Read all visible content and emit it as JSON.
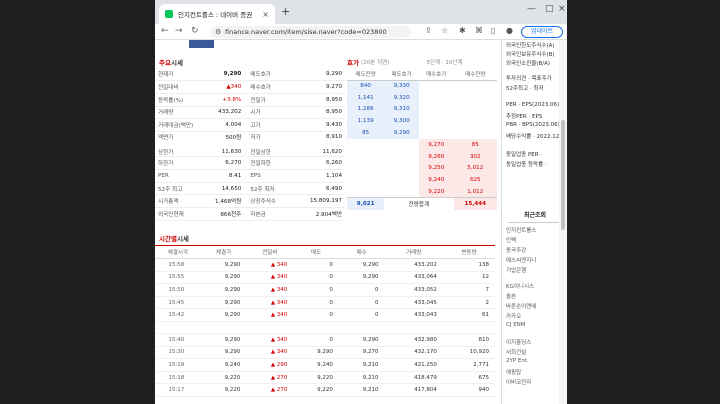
{
  "browser": {
    "tab_title": "인지컨트롤스 : 네이버 증권",
    "url": "finance.naver.com/item/sise.naver?code=023800",
    "update_label": "업데이트",
    "icons": [
      "back-icon",
      "forward-icon",
      "reload-icon",
      "tune-icon",
      "share-icon",
      "star-icon",
      "extension-icon",
      "puzzle-icon",
      "sidebar-icon",
      "profile-icon",
      "menu-icon"
    ]
  },
  "quote": {
    "title_a": "주요",
    "title_b": "시세",
    "left": [
      [
        "현재가",
        "9,290"
      ],
      [
        "전일대비",
        "▲340"
      ],
      [
        "등락률(%)",
        "+3.8%"
      ],
      [
        "거래량",
        "433,202"
      ],
      [
        "거래대금(백만)",
        "4,004"
      ],
      [
        "액면가",
        "500원"
      ],
      [
        "상한가",
        "11,630"
      ],
      [
        "하한가",
        "6,270"
      ],
      [
        "PER",
        "8.41"
      ],
      [
        "52주 최고",
        "14,650"
      ],
      [
        "시가총액",
        "1,468억원"
      ],
      [
        "외국인현재",
        "866천주"
      ]
    ],
    "right": [
      [
        "매도호가",
        "9,290"
      ],
      [
        "매수호가",
        "9,270"
      ],
      [
        "전일가",
        "8,950"
      ],
      [
        "시가",
        "8,950"
      ],
      [
        "고가",
        "9,430"
      ],
      [
        "저가",
        "8,910"
      ],
      [
        "전일상한",
        "11,620"
      ],
      [
        "전일하한",
        "6,260"
      ],
      [
        "EPS",
        "1,104"
      ],
      [
        "52주 최저",
        "6,490"
      ],
      [
        "상장주식수",
        "15,809,197"
      ],
      [
        "자본금",
        "2,904백만"
      ]
    ]
  },
  "orderbook": {
    "title": "호가",
    "sub": "(20분 지연)",
    "tenth": "· 5단계 · 10단계",
    "headers": [
      "매도잔량",
      "매도호가",
      "매수호가",
      "매수잔량"
    ],
    "asks": [
      [
        "840",
        "9,330"
      ],
      [
        "1,141",
        "9,320"
      ],
      [
        "1,286",
        "9,310"
      ],
      [
        "1,139",
        "9,300"
      ],
      [
        "85",
        "9,290"
      ]
    ],
    "bids": [
      [
        "9,270",
        "85"
      ],
      [
        "9,260",
        "302"
      ],
      [
        "9,250",
        "5,012"
      ],
      [
        "9,240",
        "625"
      ],
      [
        "9,220",
        "1,012"
      ]
    ],
    "total_ask": "9,021",
    "total_label": "잔량합계",
    "total_bid": "15,444"
  },
  "ticks": {
    "title_a": "시간별",
    "title_b": "시세",
    "headers": [
      "체결시각",
      "체결가",
      "전일비",
      "매도",
      "매수",
      "거래량",
      "변동량"
    ],
    "group1": [
      [
        "15:58",
        "9,290",
        "▲ 340",
        "0",
        "9,290",
        "433,202",
        "138"
      ],
      [
        "15:55",
        "9,290",
        "▲ 340",
        "0",
        "9,290",
        "433,064",
        "12"
      ],
      [
        "15:50",
        "9,290",
        "▲ 340",
        "0",
        "0",
        "433,052",
        "7"
      ],
      [
        "15:45",
        "9,290",
        "▲ 340",
        "0",
        "0",
        "433,045",
        "2"
      ],
      [
        "15:42",
        "9,290",
        "▲ 340",
        "0",
        "0",
        "433,043",
        "61"
      ]
    ],
    "group2": [
      [
        "15:40",
        "9,290",
        "▲ 340",
        "0",
        "9,290",
        "432,980",
        "810"
      ],
      [
        "15:30",
        "9,290",
        "▲ 340",
        "9,290",
        "9,270",
        "432,170",
        "10,920"
      ],
      [
        "15:19",
        "9,240",
        "▲ 290",
        "9,240",
        "9,210",
        "421,250",
        "2,771"
      ],
      [
        "15:18",
        "9,220",
        "▲ 270",
        "9,220",
        "9,210",
        "418,479",
        "675"
      ],
      [
        "15:17",
        "9,220",
        "▲ 270",
        "9,220",
        "9,210",
        "417,804",
        "940"
      ]
    ]
  },
  "right_panel": {
    "top_lines": [
      "외국인한도주식수(A)",
      "외국인보유주식수(B)",
      "외국인소진율(B/A)"
    ],
    "mid_lines": [
      "투자의견 · 목표주가",
      "52주최고 · 최저"
    ],
    "per_lines": [
      "PER · EPS(2023.06)",
      "추정PER · EPS",
      "PBR · BPS(2023.06)",
      "배당수익률 · 2022.12"
    ],
    "industry_lines": [
      "동일업종 PER ·",
      "동일업종 등락률 ·"
    ],
    "recent_title": "최근조회",
    "recent_group1": [
      "인지컨트롤스",
      "인팩",
      "동국주강",
      "에스씨엔지니",
      "기업은행"
    ],
    "recent_group2": [
      "KG이니시스",
      "솔본",
      "바른손이앤에",
      "카카오",
      "CJ ENM"
    ],
    "recent_group3": [
      "이지홀딩스",
      "서희건설",
      "2YP Ent.",
      "에핑탑",
      "이비코전자"
    ]
  }
}
